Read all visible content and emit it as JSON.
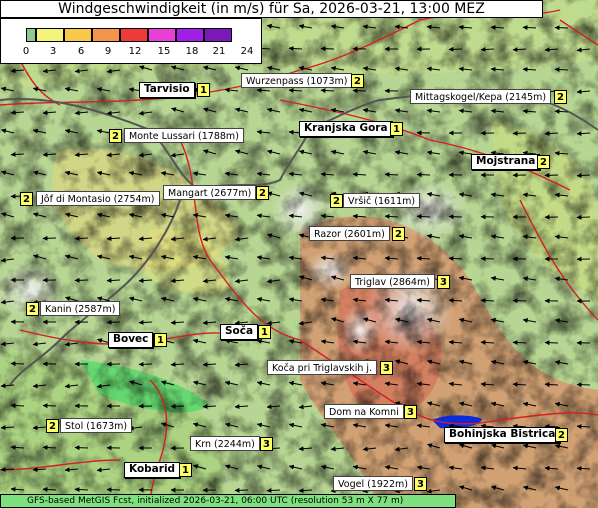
{
  "title": "Windgeschwindigkeit (in m/s) für Sa, 2026-03-21, 13:00 MEZ",
  "legend": {
    "ticks": [
      "0",
      "3",
      "6",
      "9",
      "12",
      "15",
      "18",
      "21",
      "24"
    ],
    "colors": [
      "#8fc98f",
      "#f4f47a",
      "#f6c94a",
      "#f3944a",
      "#ef3a3a",
      "#e83fd8",
      "#a21fe8",
      "#7a18b8"
    ]
  },
  "footer": "GFS-based MetGIS Fcst, initialized 2026-03-21, 06:00 UTC  (resolution 53 m X 77 m)",
  "stations": [
    {
      "label": "Wurzenpass (1073m)",
      "value": "2",
      "type": "peak"
    },
    {
      "label": "Tarvisio",
      "value": "1",
      "type": "town"
    },
    {
      "label": "Mittagskogel/Kepa (2145m)",
      "value": "2",
      "type": "peak"
    },
    {
      "label": "Monte Lussari (1788m)",
      "value": "2",
      "type": "peak"
    },
    {
      "label": "Kranjska Gora",
      "value": "1",
      "type": "town"
    },
    {
      "label": "Mojstrana",
      "value": "2",
      "type": "town"
    },
    {
      "label": "Jôf di Montasio (2754m)",
      "value": "2",
      "type": "peak"
    },
    {
      "label": "Mangart (2677m)",
      "value": "2",
      "type": "peak"
    },
    {
      "label": "Vršič (1611m)",
      "value": "2",
      "type": "peak"
    },
    {
      "label": "Razor (2601m)",
      "value": "2",
      "type": "peak"
    },
    {
      "label": "Triglav (2864m)",
      "value": "3",
      "type": "peak"
    },
    {
      "label": "Kanin (2587m)",
      "value": "2",
      "type": "peak"
    },
    {
      "label": "Soča",
      "value": "1",
      "type": "town"
    },
    {
      "label": "Bovec",
      "value": "1",
      "type": "town"
    },
    {
      "label": "Koča pri Triglavskih j.",
      "value": "3",
      "type": "peak"
    },
    {
      "label": "Dom na Komni",
      "value": "3",
      "type": "peak"
    },
    {
      "label": "Stol (1673m)",
      "value": "2",
      "type": "peak"
    },
    {
      "label": "Bohinjska Bistrica",
      "value": "2",
      "type": "town"
    },
    {
      "label": "Krn (2244m)",
      "value": "3",
      "type": "peak"
    },
    {
      "label": "Kobarid",
      "value": "1",
      "type": "town"
    },
    {
      "label": "Vogel (1922m)",
      "value": "3",
      "type": "peak"
    }
  ]
}
